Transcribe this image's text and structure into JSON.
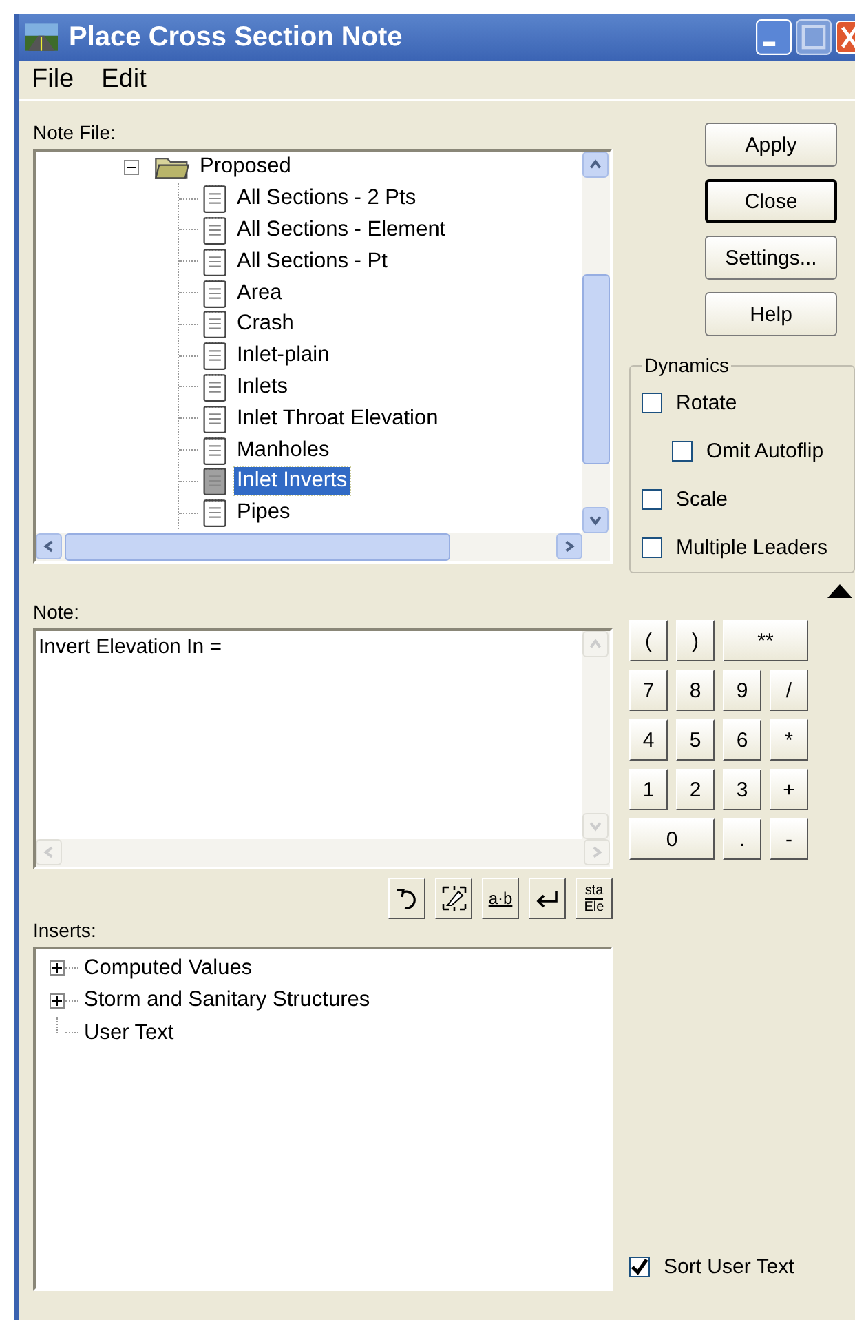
{
  "window": {
    "title": "Place Cross Section Note"
  },
  "menu": [
    "File",
    "Edit"
  ],
  "note_file": {
    "label": "Note File:",
    "tree": [
      {
        "label": "Proposed",
        "expanded": true,
        "children": [
          {
            "label": "All Sections - 2 Pts",
            "selected": false
          },
          {
            "label": "All Sections - Element",
            "selected": false
          },
          {
            "label": "All Sections - Pt",
            "selected": false
          },
          {
            "label": "Area",
            "selected": false
          },
          {
            "label": "Crash",
            "selected": false
          },
          {
            "label": "Inlet-plain",
            "selected": false
          },
          {
            "label": "Inlets",
            "selected": false
          },
          {
            "label": "Inlet Throat Elevation",
            "selected": false
          },
          {
            "label": "Manholes",
            "selected": false
          },
          {
            "label": "Inlet Inverts",
            "selected": true
          },
          {
            "label": "Pipes",
            "selected": false
          }
        ]
      }
    ]
  },
  "buttons": [
    {
      "label": "Apply",
      "focused": false
    },
    {
      "label": "Close",
      "focused": true
    },
    {
      "label": "Settings...",
      "focused": false
    },
    {
      "label": "Help",
      "focused": false
    }
  ],
  "dynamics": {
    "title": "Dynamics",
    "options": [
      {
        "label": "Rotate",
        "checked": false,
        "children": [
          {
            "label": "Omit Autoflip",
            "checked": false
          }
        ]
      },
      {
        "label": "Scale",
        "checked": false
      },
      {
        "label": "Multiple Leaders",
        "checked": false
      }
    ]
  },
  "note": {
    "label": "Note:",
    "value": "Invert Elevation In ="
  },
  "keypad": [
    {
      "label": "(",
      "kind": "key"
    },
    {
      "label": ")",
      "kind": "key"
    },
    {
      "label": "**",
      "kind": "wide"
    },
    {
      "label": "7",
      "kind": "key"
    },
    {
      "label": "8",
      "kind": "key"
    },
    {
      "label": "9",
      "kind": "key"
    },
    {
      "label": "/",
      "kind": "key"
    },
    {
      "label": "4",
      "kind": "key"
    },
    {
      "label": "5",
      "kind": "key"
    },
    {
      "label": "6",
      "kind": "key"
    },
    {
      "label": "*",
      "kind": "key"
    },
    {
      "label": "1",
      "kind": "key"
    },
    {
      "label": "2",
      "kind": "key"
    },
    {
      "label": "3",
      "kind": "key"
    },
    {
      "label": "+",
      "kind": "key"
    },
    {
      "label": "0",
      "kind": "wide"
    },
    {
      "label": ".",
      "kind": "key"
    },
    {
      "label": "-",
      "kind": "key"
    }
  ],
  "toolbar": [
    {
      "kind": "undo"
    },
    {
      "kind": "fit"
    },
    {
      "kind": "join",
      "label": "a·b"
    },
    {
      "kind": "enter"
    },
    {
      "kind": "station",
      "label": "sta",
      "label2": "Ele"
    }
  ],
  "inserts": {
    "label": "Inserts:",
    "tree": [
      {
        "label": "Computed Values",
        "kind": "group",
        "expanded": false
      },
      {
        "label": "Storm and Sanitary Structures",
        "kind": "group",
        "expanded": false
      },
      {
        "label": "User Text",
        "kind": "leaf"
      }
    ]
  },
  "sort_user_text": {
    "label": "Sort User Text",
    "checked": true
  }
}
